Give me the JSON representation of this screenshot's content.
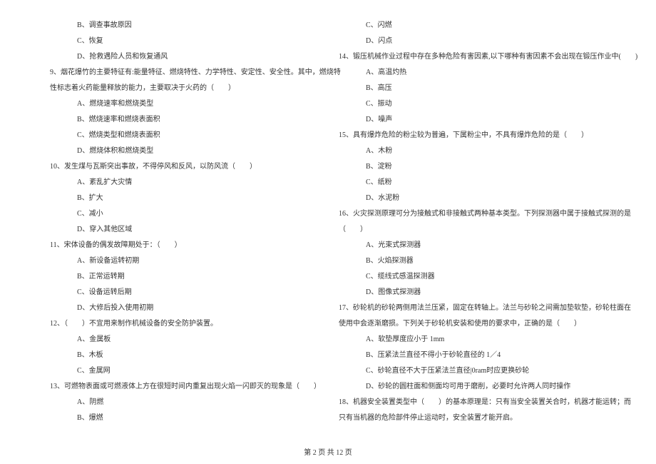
{
  "left_column": [
    {
      "cls": "option",
      "text": "B、调查事故原因"
    },
    {
      "cls": "option",
      "text": "C、恢复"
    },
    {
      "cls": "option",
      "text": "D、抢救遇险人员和恢复通风"
    },
    {
      "cls": "question",
      "text": "9、烟花爆竹的主要特征有:能量特征、燃烧特性、力学特性、安定性、安全性。其中，燃烧特"
    },
    {
      "cls": "question-cont",
      "text": "性标志着火药能量释放的能力，主要取决于火药的（　　）"
    },
    {
      "cls": "option",
      "text": "A、燃烧速率和燃烧类型"
    },
    {
      "cls": "option",
      "text": "B、燃烧速率和燃烧表面积"
    },
    {
      "cls": "option",
      "text": "C、燃烧类型和燃烧表面积"
    },
    {
      "cls": "option",
      "text": "D、燃烧体积和燃烧类型"
    },
    {
      "cls": "question",
      "text": "10、发生煤与瓦斯突出事故，不得停风和反风，以防风流（　　）"
    },
    {
      "cls": "option",
      "text": "A、紊乱扩大灾情"
    },
    {
      "cls": "option",
      "text": "B、扩大"
    },
    {
      "cls": "option",
      "text": "C、减小"
    },
    {
      "cls": "option",
      "text": "D、穿入其他区域"
    },
    {
      "cls": "question",
      "text": "11、宋体设备的偶发故障期处于：（　　）"
    },
    {
      "cls": "option",
      "text": "A、新设备运转初期"
    },
    {
      "cls": "option",
      "text": "B、正常运转期"
    },
    {
      "cls": "option",
      "text": "C、设备运转后期"
    },
    {
      "cls": "option",
      "text": "D、大修后投入使用初期"
    },
    {
      "cls": "question",
      "text": "12、（　　）不宜用来制作机械设备的安全防护装置。"
    },
    {
      "cls": "option",
      "text": "A、金属板"
    },
    {
      "cls": "option",
      "text": "B、木板"
    },
    {
      "cls": "option",
      "text": "C、金属网"
    },
    {
      "cls": "question",
      "text": "13、可燃物表面或可燃液体上方在很短时间内重复出现火焰一闪即灭的现象是（　　）"
    },
    {
      "cls": "option",
      "text": "A、阴燃"
    },
    {
      "cls": "option",
      "text": "B、爆燃"
    }
  ],
  "right_column": [
    {
      "cls": "option",
      "text": "C、闪燃"
    },
    {
      "cls": "option",
      "text": "D、闪点"
    },
    {
      "cls": "question",
      "text": "14、锻压机械作业过程中存在多种危险有害因素,以下哪种有害因素不会出现在锻压作业中(　　)"
    },
    {
      "cls": "option",
      "text": "A、高温灼热"
    },
    {
      "cls": "option",
      "text": "B、高压"
    },
    {
      "cls": "option",
      "text": "C、振动"
    },
    {
      "cls": "option",
      "text": "D、噪声"
    },
    {
      "cls": "question",
      "text": "15、具有爆炸危险的粉尘较为普遍，下属粉尘中，不具有爆炸危险的是（　　）"
    },
    {
      "cls": "option",
      "text": "A、木粉"
    },
    {
      "cls": "option",
      "text": "B、淀粉"
    },
    {
      "cls": "option",
      "text": "C、纸粉"
    },
    {
      "cls": "option",
      "text": "D、水泥粉"
    },
    {
      "cls": "question",
      "text": "16、火灾探测原理可分为接触式和非接触式两种基本类型。下列探测器中属于接触式探测的是"
    },
    {
      "cls": "question-cont",
      "text": "（　　）"
    },
    {
      "cls": "option",
      "text": "A、光束式探测器"
    },
    {
      "cls": "option",
      "text": "B、火焰探测器"
    },
    {
      "cls": "option",
      "text": "C、缆线式感温探测器"
    },
    {
      "cls": "option",
      "text": "D、图像式探测器"
    },
    {
      "cls": "question",
      "text": "17、砂轮机的砂轮两侧用法兰压紧，固定在转轴上。法兰与砂轮之间需加垫软垫，砂轮柱面在"
    },
    {
      "cls": "question-cont",
      "text": "使用中会逐渐磨损。下列关于砂轮机安装和使用的要求中，正确的是（　　）"
    },
    {
      "cls": "option",
      "text": "A、软垫厚度应小于 1mm"
    },
    {
      "cls": "option",
      "text": "B、压紧法兰直径不得小于砂轮直径的 1／4"
    },
    {
      "cls": "option",
      "text": "C、砂轮直径不大于压紧法兰直径|0ram时应更换砂轮"
    },
    {
      "cls": "option",
      "text": "D、砂轮的圆柱面和侧面均可用于磨削，必要时允许两人同时操作"
    },
    {
      "cls": "question",
      "text": "18、机器安全装置类型中（　　）的基本原理是：只有当安全装置关合时，机器才能运转；而"
    },
    {
      "cls": "question-cont",
      "text": "只有当机器的危险部件停止运动时，安全装置才能开启。"
    }
  ],
  "footer": "第 2 页 共 12 页"
}
